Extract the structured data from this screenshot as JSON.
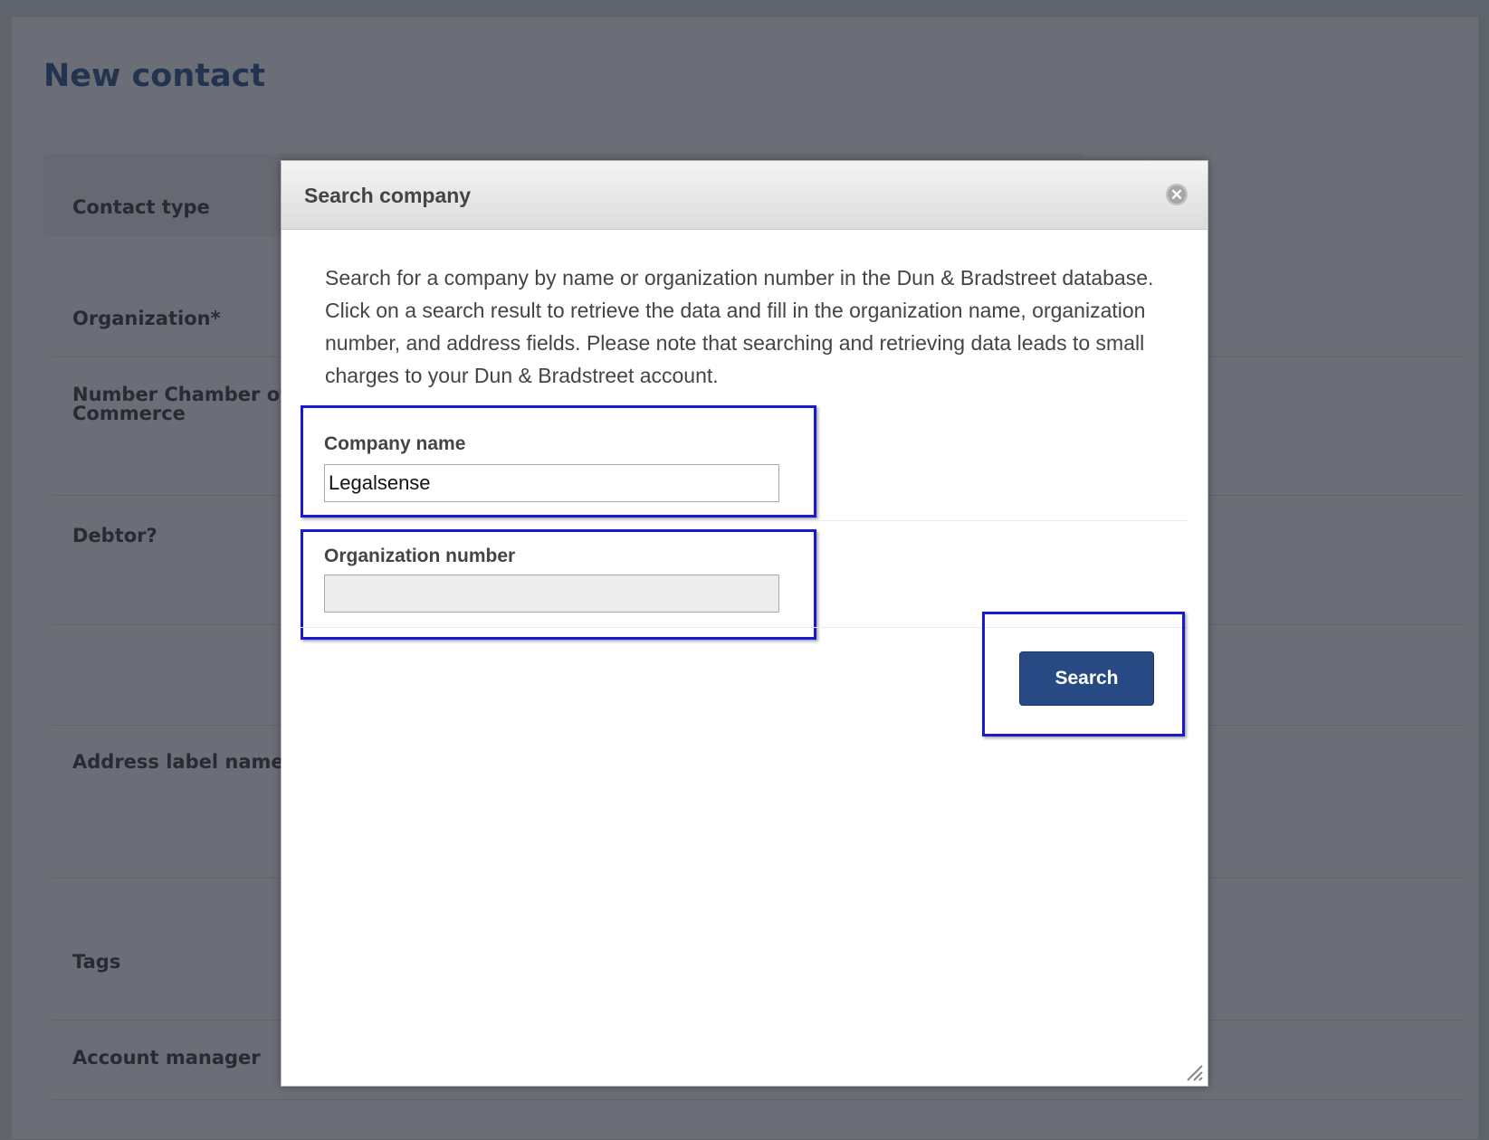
{
  "background": {
    "page_title": "New contact",
    "fields": [
      {
        "label": "Contact type"
      },
      {
        "label": "Organization*"
      },
      {
        "label": "Number Chamber of Commerce"
      },
      {
        "label": "Debtor?"
      },
      {
        "label": "Address label name"
      },
      {
        "label": "Tags"
      },
      {
        "label": "Account manager"
      }
    ]
  },
  "modal": {
    "title": "Search company",
    "close_icon": "close-icon",
    "description": "Search for a company by name or organization number in the Dun & Bradstreet database. Click on a search result to retrieve the data and fill in the organization name, organization number, and address fields. Please note that searching and retrieving data leads to small charges to your Dun & Bradstreet account.",
    "company_name": {
      "label": "Company name",
      "value": "Legalsense"
    },
    "organization_number": {
      "label": "Organization number",
      "value": ""
    },
    "search_button": "Search",
    "resize_icon": "resize-handle-icon"
  },
  "colors": {
    "overlay": "#5f636b",
    "title_blue": "#22344f",
    "button_blue": "#274a85",
    "highlight_border": "#1919d2"
  }
}
